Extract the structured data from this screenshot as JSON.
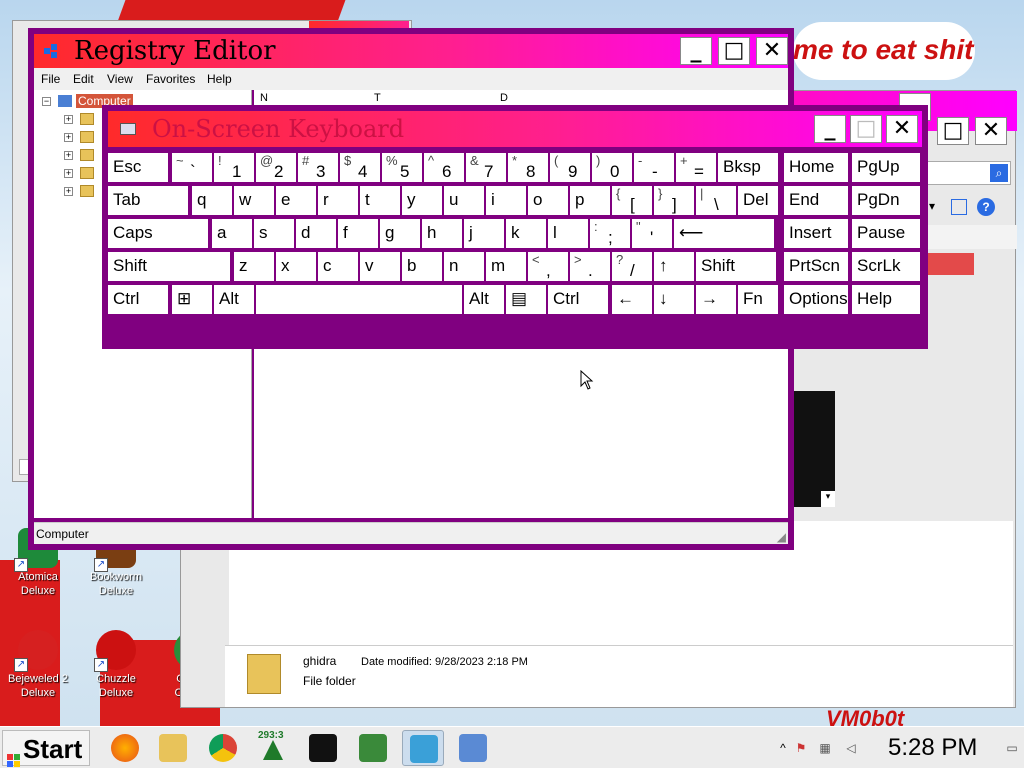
{
  "desktop": {
    "banner_text": "me to eat shit",
    "watermark": "VM0b0t",
    "icons": [
      {
        "label_line1": "Atomica",
        "label_line2": "Deluxe",
        "color": "#1e8a3a"
      },
      {
        "label_line1": "Bookworm",
        "label_line2": "Deluxe",
        "color": "#7a3e12"
      },
      {
        "label_line1": "Bejeweled 2",
        "label_line2": "Deluxe",
        "color": "#d62020"
      },
      {
        "label_line1": "Chuzzle",
        "label_line2": "Deluxe",
        "color": "#cc1111"
      },
      {
        "label_line1": "Google",
        "label_line2": "Chrome",
        "color": "#2a8d3a"
      }
    ]
  },
  "explorer": {
    "item_name": "ghidra",
    "item_meta": "Date modified: 9/28/2023 2:18 PM",
    "item_type": "File folder"
  },
  "regedit": {
    "title": "Registry Editor",
    "menu": [
      "File",
      "Edit",
      "View",
      "Favorites",
      "Help"
    ],
    "tree_root": "Computer",
    "status": "Computer",
    "columns": [
      "N",
      "T",
      "D"
    ]
  },
  "osk": {
    "title": "On-Screen Keyboard",
    "rows": [
      [
        {
          "label": "Esc"
        },
        {
          "shift": "~",
          "main": "`"
        },
        {
          "shift": "!",
          "main": "1"
        },
        {
          "shift": "@",
          "main": "2"
        },
        {
          "shift": "#",
          "main": "3"
        },
        {
          "shift": "$",
          "main": "4"
        },
        {
          "shift": "%",
          "main": "5"
        },
        {
          "shift": "^",
          "main": "6"
        },
        {
          "shift": "&",
          "main": "7"
        },
        {
          "shift": "*",
          "main": "8"
        },
        {
          "shift": "(",
          "main": "9"
        },
        {
          "shift": ")",
          "main": "0"
        },
        {
          "shift": "-",
          "main": "-"
        },
        {
          "shift": "+",
          "main": "="
        },
        {
          "label": "Bksp"
        },
        {
          "label": "Home"
        },
        {
          "label": "PgUp"
        }
      ],
      [
        {
          "label": "Tab"
        },
        {
          "label": "q"
        },
        {
          "label": "w"
        },
        {
          "label": "e"
        },
        {
          "label": "r"
        },
        {
          "label": "t"
        },
        {
          "label": "y"
        },
        {
          "label": "u"
        },
        {
          "label": "i"
        },
        {
          "label": "o"
        },
        {
          "label": "p"
        },
        {
          "shift": "{",
          "main": "["
        },
        {
          "shift": "}",
          "main": "]"
        },
        {
          "shift": "|",
          "main": "\\"
        },
        {
          "label": "Del"
        },
        {
          "label": "End"
        },
        {
          "label": "PgDn"
        }
      ],
      [
        {
          "label": "Caps"
        },
        {
          "label": "a"
        },
        {
          "label": "s"
        },
        {
          "label": "d"
        },
        {
          "label": "f"
        },
        {
          "label": "g"
        },
        {
          "label": "h"
        },
        {
          "label": "j"
        },
        {
          "label": "k"
        },
        {
          "label": "l"
        },
        {
          "shift": ":",
          "main": ";"
        },
        {
          "shift": "\"",
          "main": "'"
        },
        {
          "label": "⟵"
        },
        {
          "label": "Insert"
        },
        {
          "label": "Pause"
        }
      ],
      [
        {
          "label": "Shift"
        },
        {
          "label": "z"
        },
        {
          "label": "x"
        },
        {
          "label": "c"
        },
        {
          "label": "v"
        },
        {
          "label": "b"
        },
        {
          "label": "n"
        },
        {
          "label": "m"
        },
        {
          "shift": "<",
          "main": ","
        },
        {
          "shift": ">",
          "main": "."
        },
        {
          "shift": "?",
          "main": "/"
        },
        {
          "label": "↑"
        },
        {
          "label": "Shift"
        },
        {
          "label": "PrtScn"
        },
        {
          "label": "ScrLk"
        }
      ],
      [
        {
          "label": "Ctrl"
        },
        {
          "label": "⊞"
        },
        {
          "label": "Alt"
        },
        {
          "label": ""
        },
        {
          "label": "Alt"
        },
        {
          "label": "▤"
        },
        {
          "label": "Ctrl"
        },
        {
          "label": "←"
        },
        {
          "label": "↓"
        },
        {
          "label": "→"
        },
        {
          "label": "Fn"
        },
        {
          "label": "Options"
        },
        {
          "label": "Help"
        }
      ]
    ]
  },
  "taskbar": {
    "start_label": "Start",
    "badge": "293:3",
    "clock": "5:28 PM"
  }
}
